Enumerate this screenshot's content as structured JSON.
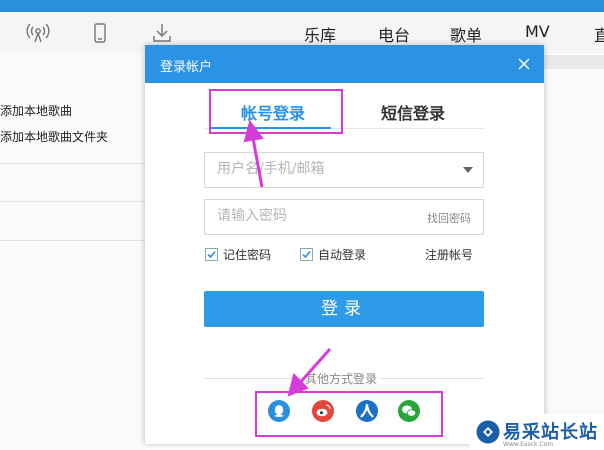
{
  "toolbar": {
    "icons": [
      "radio-icon",
      "phone-icon",
      "download-icon"
    ],
    "nav_tabs": [
      "乐库",
      "电台",
      "歌单",
      "MV",
      "直"
    ]
  },
  "left_panel": {
    "items": [
      "添加本地歌曲",
      "添加本地歌曲文件夹"
    ]
  },
  "dialog": {
    "title": "登录帐户",
    "tabs": {
      "account": "帐号登录",
      "sms": "短信登录"
    },
    "username_placeholder": "用户名/手机/邮箱",
    "password_placeholder": "请输入密码",
    "forgot_password": "找回密码",
    "remember_password": "记住密码",
    "auto_login": "自动登录",
    "register": "注册帐号",
    "login_button": "登录",
    "other_methods": "其他方式登录",
    "social_logins": [
      "qq-icon",
      "weibo-icon",
      "renren-icon",
      "wechat-icon"
    ]
  },
  "colors": {
    "accent": "#2b93e4",
    "highlight": "#d63ad8",
    "brand_watermark": "#1d5ea8"
  },
  "watermark": {
    "name": "易采站长站",
    "sub": "Www.Easck.Com"
  }
}
